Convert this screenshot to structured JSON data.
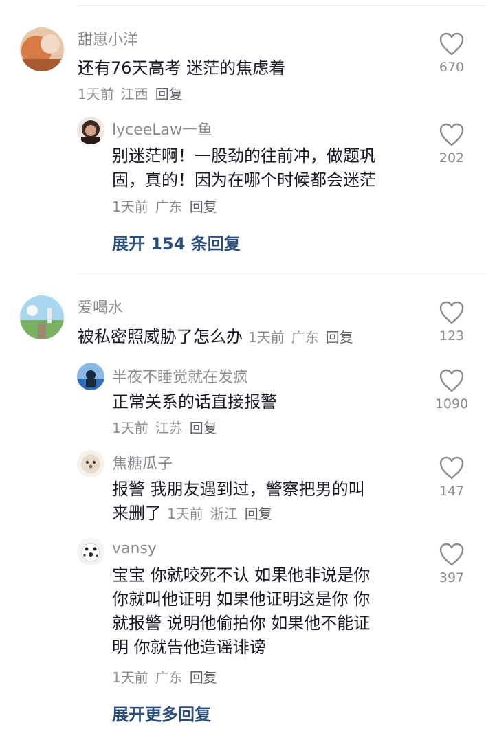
{
  "comments": [
    {
      "user": "甜崽小洋",
      "text": "还有76天高考 迷茫的焦虑着",
      "time": "1天前",
      "location": "江西",
      "reply": "回复",
      "likes": "670",
      "avatar_colors": [
        "#e9a77a",
        "#b5603a",
        "#f3d2b8"
      ]
    },
    {
      "user": "lyceeLaw一鱼",
      "text_lines": [
        "别迷茫啊！一股劲的往前冲，做题巩",
        "固，真的！因为在哪个时候都会迷茫"
      ],
      "time": "1天前",
      "location": "广东",
      "reply": "回复",
      "likes": "202",
      "avatar_colors": [
        "#f0e7e1",
        "#3a2a26",
        "#c99583"
      ]
    },
    {
      "expand_label": "展开 154 条回复"
    },
    {
      "user": "爱喝水",
      "text": "被私密照威胁了怎么办",
      "time": "1天前",
      "location": "广东",
      "reply": "回复",
      "likes": "123",
      "avatar_colors": [
        "#9ccfe6",
        "#6aa85a",
        "#e6eef2"
      ]
    },
    {
      "user": "半夜不睡觉就在发疯",
      "text": "正常关系的话直接报警",
      "time": "1天前",
      "location": "江苏",
      "reply": "回复",
      "likes": "1090",
      "avatar_colors": [
        "#2f6fb8",
        "#1b2a3d",
        "#9cc3ea"
      ]
    },
    {
      "user": "焦糖瓜子",
      "text_lines": [
        "报警 我朋友遇到过，警察把男的叫",
        "来删了"
      ],
      "time": "1天前",
      "location": "浙江",
      "reply": "回复",
      "likes": "147",
      "avatar_colors": [
        "#f5efe8",
        "#d8c3ad",
        "#8b6d56"
      ]
    },
    {
      "user": "vansy",
      "text_lines": [
        "宝宝 你就咬死不认 如果他非说是你",
        "你就叫他证明 如果他证明这是你 你",
        "就报警 说明他偷拍你 如果他不能证",
        "明 你就告他造谣诽谤"
      ],
      "time": "1天前",
      "location": "广东",
      "reply": "回复",
      "likes": "397",
      "avatar_colors": [
        "#f2f2f2",
        "#222222",
        "#bdbdbd"
      ]
    },
    {
      "expand_label": "展开更多回复"
    }
  ],
  "colors": {
    "name": "#8a8b91",
    "text": "#161823",
    "expand": "#2b4f7a"
  },
  "icons": {
    "like": "heart-outline-icon"
  }
}
